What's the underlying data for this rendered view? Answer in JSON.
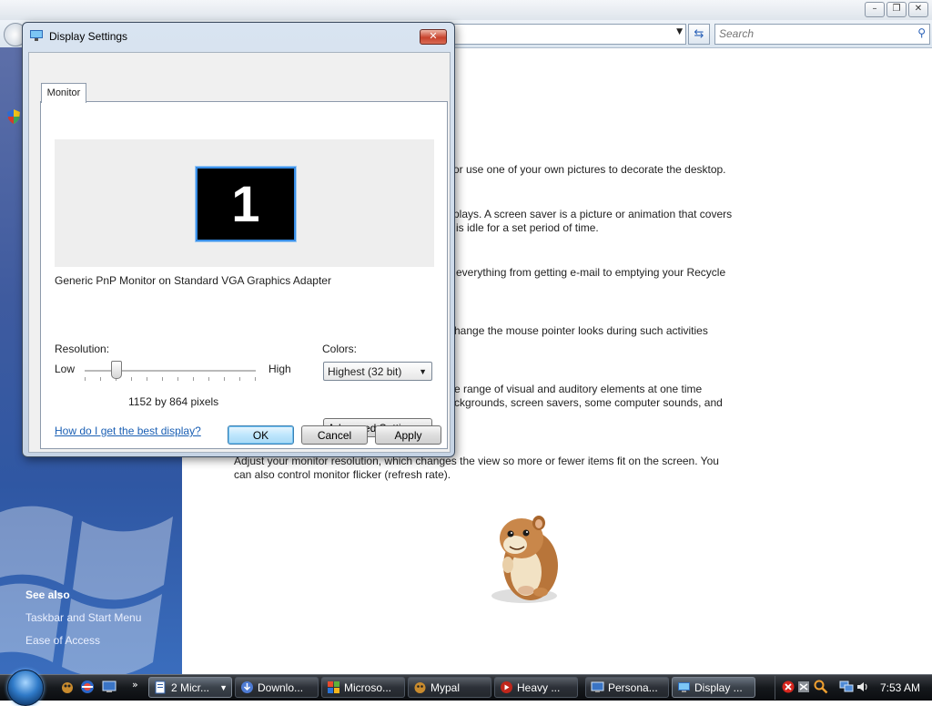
{
  "background_window": {
    "search_placeholder": "Search",
    "content_lines": [
      "or use one of your own pictures to decorate the desktop.",
      "plays. A screen saver is a picture or animation that covers",
      "is idle for a set period of time.",
      "everything from getting e-mail to emptying your Recycle",
      "hange the mouse pointer looks during such activities",
      "e range of visual and auditory elements at one time",
      "ckgrounds, screen savers, some computer sounds, and",
      "Adjust your monitor resolution, which changes the view so more or fewer items fit on the screen. You",
      "can also control monitor flicker (refresh rate)."
    ],
    "sidebar": {
      "see_also": "See also",
      "links": [
        "Taskbar and Start Menu",
        "Ease of Access"
      ]
    }
  },
  "dialog": {
    "title": "Display Settings",
    "close_glyph": "✕",
    "tab_label": "Monitor",
    "monitor_number": "1",
    "monitor_description": "Generic PnP Monitor on Standard VGA Graphics Adapter",
    "resolution_label": "Resolution:",
    "slider_low": "Low",
    "slider_high": "High",
    "resolution_value": "1152 by 864 pixels",
    "colors_label": "Colors:",
    "colors_selected": "Highest (32 bit)",
    "help_link": "How do I get the best display?",
    "advanced_button": "Advanced Settings...",
    "ok_button": "OK",
    "cancel_button": "Cancel",
    "apply_button": "Apply"
  },
  "taskbar": {
    "buttons": [
      {
        "label": "2 Micr...",
        "icon": "documents-icon"
      },
      {
        "label": "Downlo...",
        "icon": "download-icon"
      },
      {
        "label": "Microso...",
        "icon": "office-icon"
      },
      {
        "label": "Mypal",
        "icon": "browser-icon"
      },
      {
        "label": "Heavy ...",
        "icon": "media-icon"
      },
      {
        "label": "Persona...",
        "icon": "personalize-icon"
      },
      {
        "label": "Display ...",
        "icon": "display-icon"
      }
    ],
    "clock": "7:53 AM"
  }
}
